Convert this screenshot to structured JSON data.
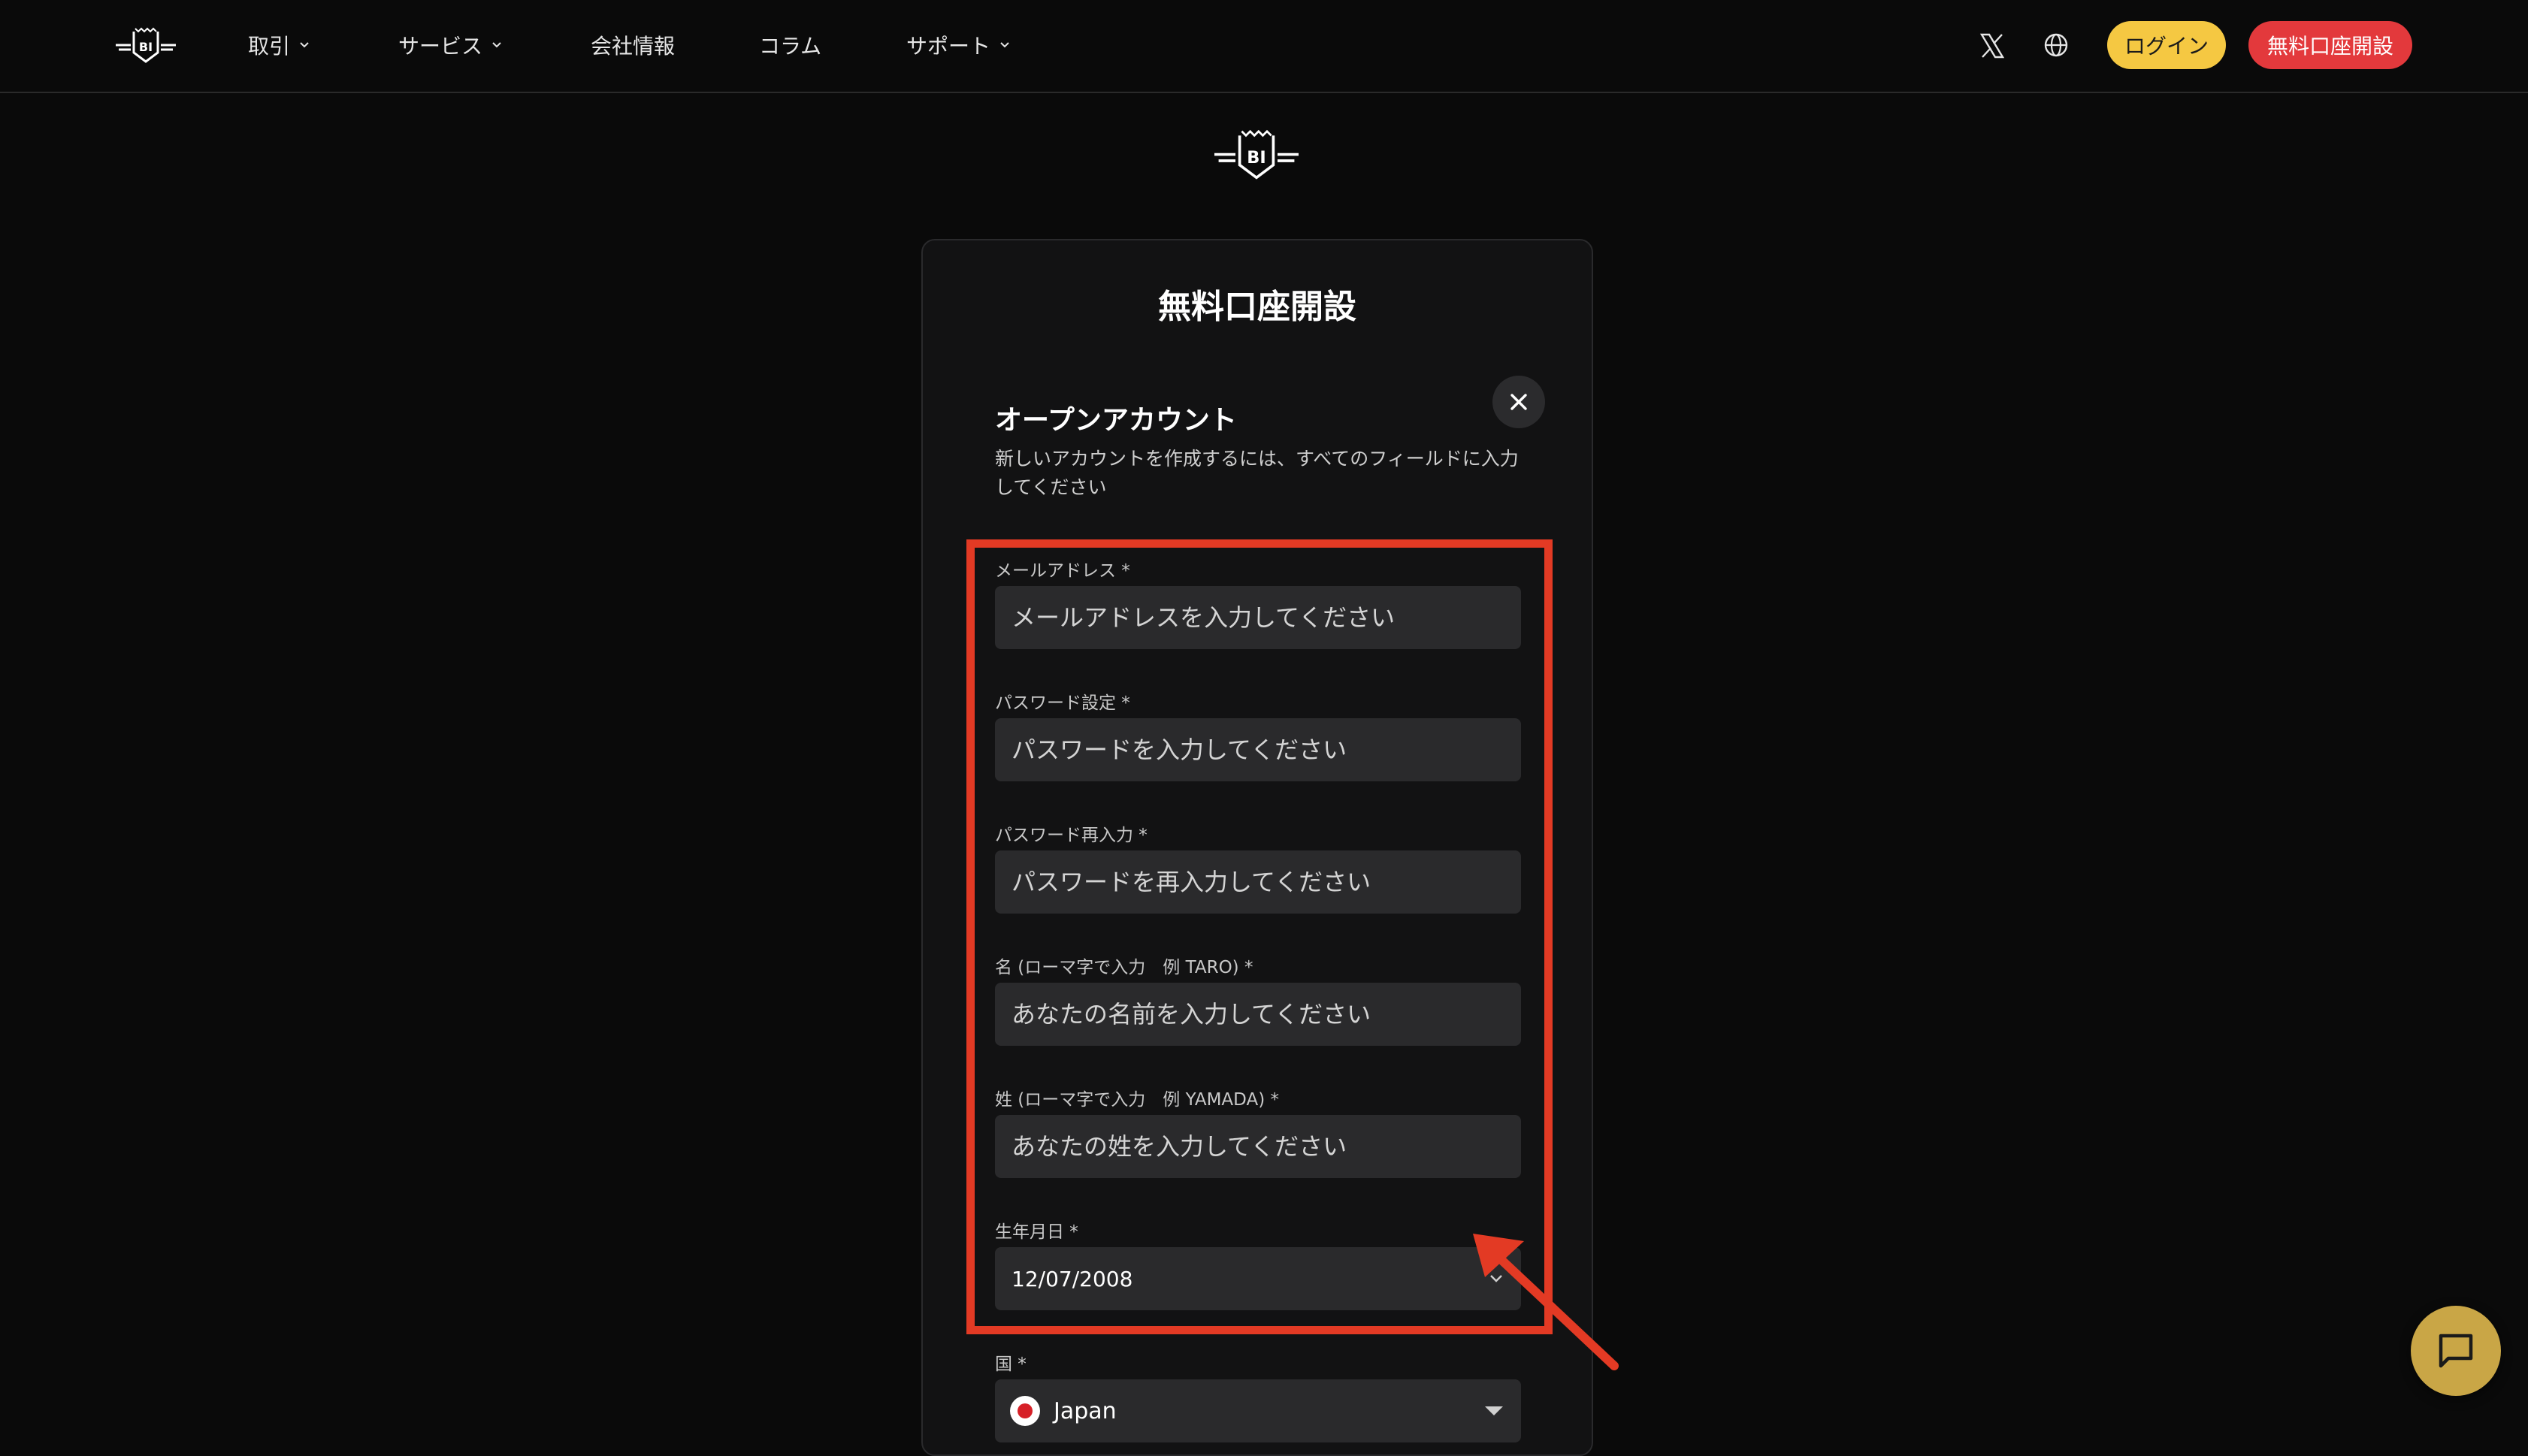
{
  "header": {
    "nav": [
      {
        "label": "取引",
        "has_dropdown": true
      },
      {
        "label": "サービス",
        "has_dropdown": true
      },
      {
        "label": "会社情報",
        "has_dropdown": false
      },
      {
        "label": "コラム",
        "has_dropdown": false
      },
      {
        "label": "サポート",
        "has_dropdown": true
      }
    ],
    "icons": [
      "x-icon",
      "globe-icon"
    ],
    "login_label": "ログイン",
    "open_account_label": "無料口座開設"
  },
  "logo_text": "BI",
  "card": {
    "title": "無料口座開設",
    "form_heading": "オープンアカウント",
    "form_description": "新しいアカウントを作成するには、すべてのフィールドに入力してください",
    "fields": [
      {
        "label": "メールアドレス *",
        "placeholder": "メールアドレスを入力してください"
      },
      {
        "label": "パスワード設定 *",
        "placeholder": "パスワードを入力してください"
      },
      {
        "label": "パスワード再入力 *",
        "placeholder": "パスワードを再入力してください"
      },
      {
        "label": "名 (ローマ字で入力　例 TARO) *",
        "placeholder": "あなたの名前を入力してください"
      },
      {
        "label": "姓 (ローマ字で入力　例 YAMADA) *",
        "placeholder": "あなたの姓を入力してください"
      }
    ],
    "birthdate": {
      "label": "生年月日 *",
      "value": "12/07/2008"
    },
    "country": {
      "label": "国 *",
      "value": "Japan"
    }
  },
  "colors": {
    "accent_yellow": "#f5c842",
    "accent_red": "#e3393c",
    "annotation_red": "#e33a24",
    "chat_gold": "#c9a646",
    "background": "#0a0a0a"
  }
}
